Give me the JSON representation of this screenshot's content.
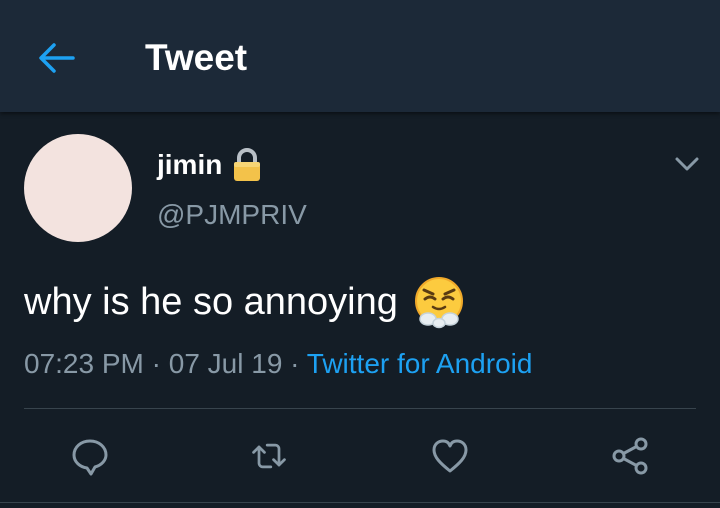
{
  "header": {
    "title": "Tweet",
    "back_icon": "arrow-left-icon"
  },
  "tweet": {
    "author_name": "jimin",
    "locked_icon": "lock-icon",
    "handle": "@PJMPRIV",
    "text": "why is he so annoying",
    "emoji_icon": "face-with-steam-from-nose-emoji",
    "time": "07:23 PM",
    "separator": " · ",
    "date": "07 Jul 19",
    "source": "Twitter for Android",
    "menu_icon": "chevron-down-icon"
  },
  "actions": [
    {
      "icon": "reply-icon"
    },
    {
      "icon": "retweet-icon"
    },
    {
      "icon": "like-icon"
    },
    {
      "icon": "share-icon"
    }
  ],
  "colors": {
    "background": "#141d26",
    "header_background": "#1c2938",
    "accent": "#1da1f2",
    "secondary_text": "#8899a6",
    "divider": "#38444d",
    "avatar": "#f3e3df"
  }
}
